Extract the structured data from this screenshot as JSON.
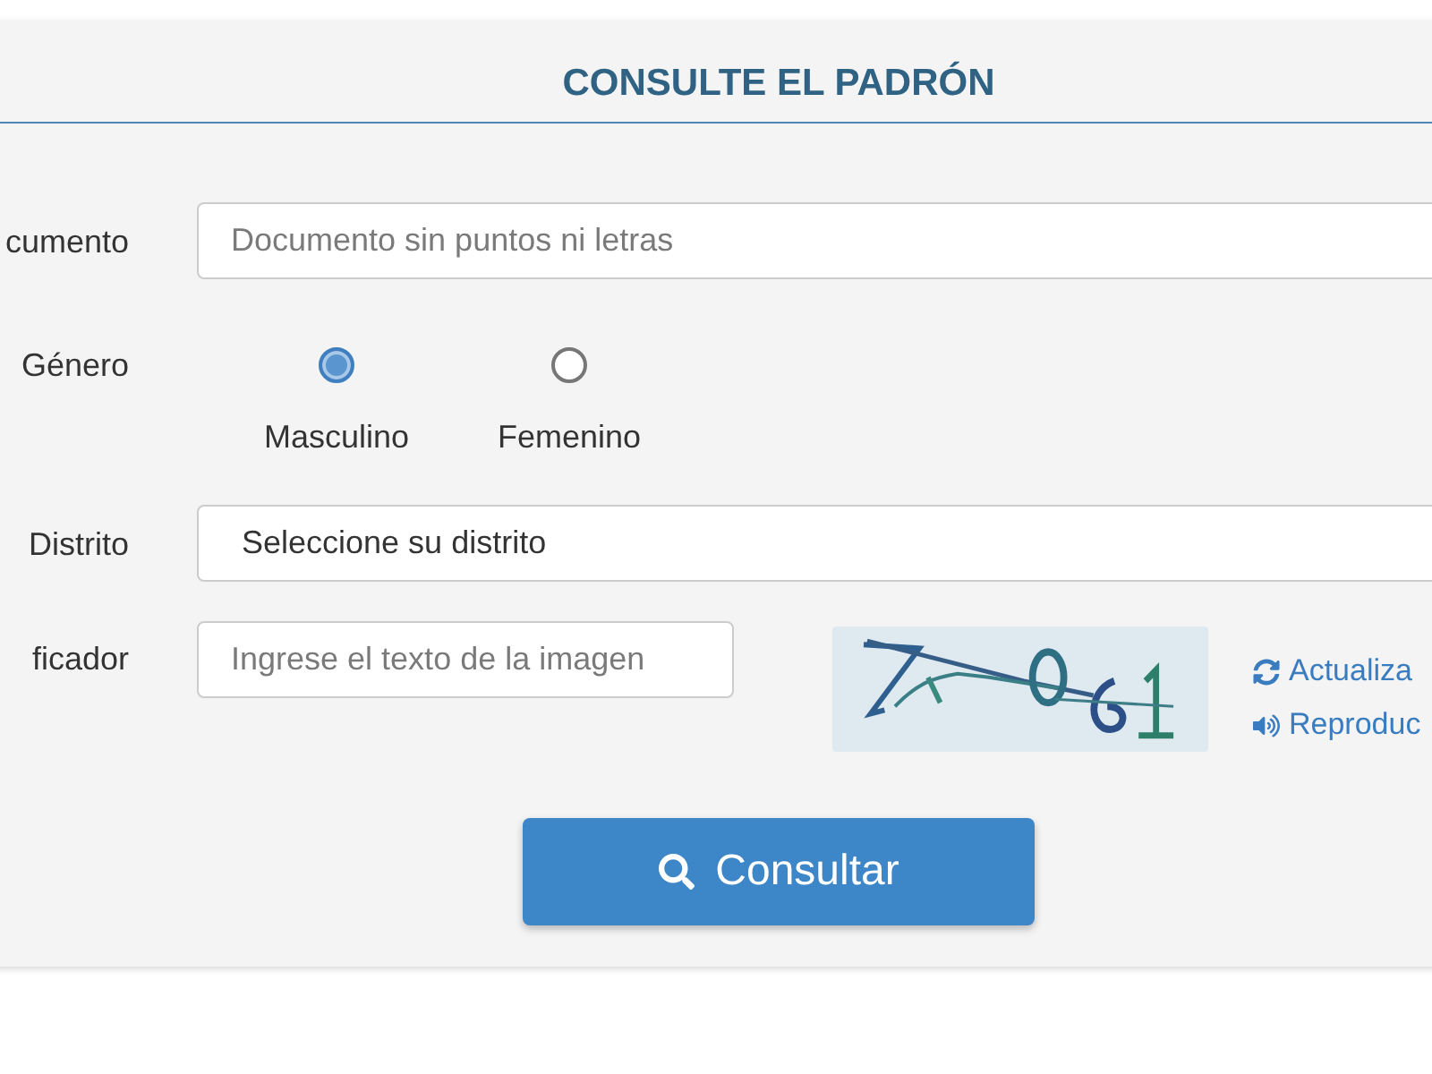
{
  "title": "CONSULTE EL PADRÓN",
  "fields": [
    {
      "kind": "text",
      "label": "cumento",
      "placeholder": "Documento sin puntos ni letras"
    },
    {
      "kind": "radio",
      "label": "Género",
      "options": [
        {
          "label": "Masculino",
          "selected": true
        },
        {
          "label": "Femenino",
          "selected": false
        }
      ]
    },
    {
      "kind": "select",
      "label": "Distrito",
      "value": "Seleccione su distrito"
    },
    {
      "kind": "captcha",
      "label": "ficador",
      "placeholder": "Ingrese el texto de la imagen",
      "links": [
        {
          "kind": "refresh",
          "label": "Actualiza"
        },
        {
          "kind": "audio",
          "label": "Reproduc"
        }
      ]
    }
  ],
  "submit": {
    "label": "Consultar"
  }
}
